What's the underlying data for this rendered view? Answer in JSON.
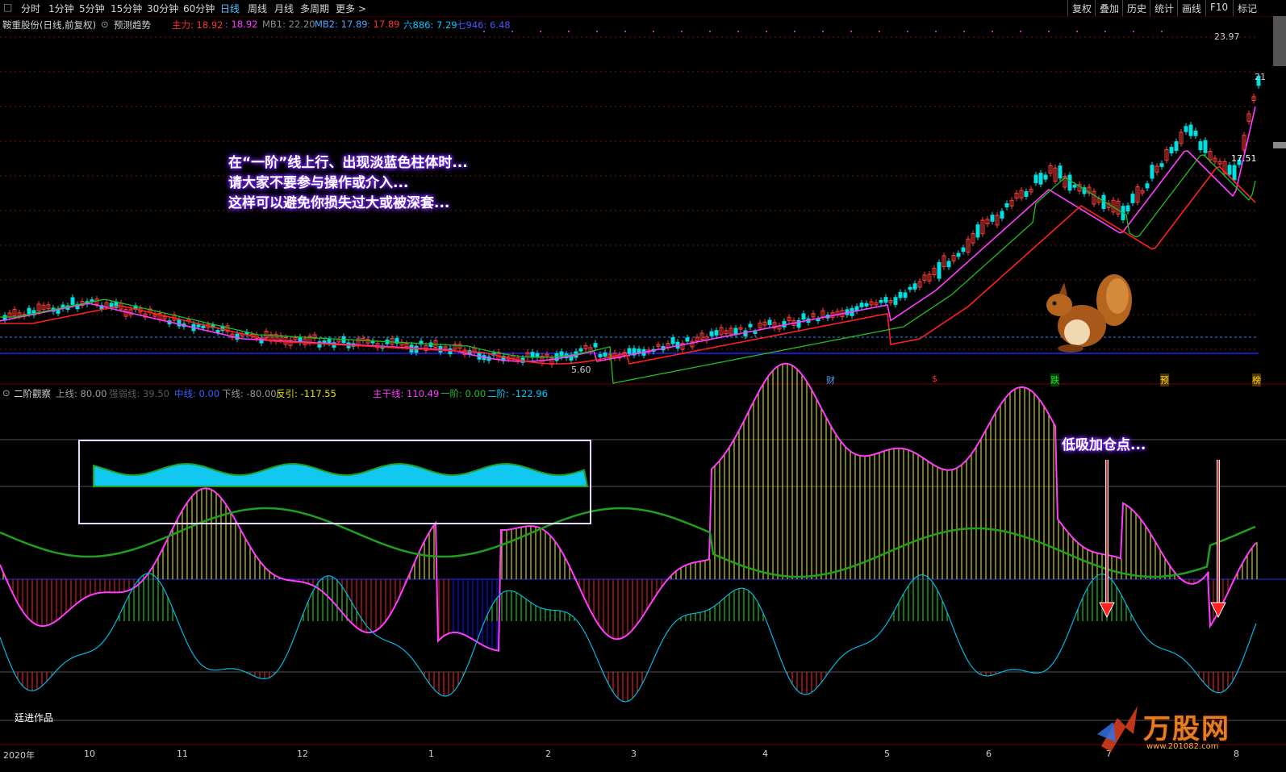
{
  "toolbar": {
    "periods": [
      "分时",
      "1分钟",
      "5分钟",
      "15分钟",
      "30分钟",
      "60分钟",
      "日线",
      "周线",
      "月线",
      "多周期",
      "更多 >"
    ],
    "active_period": "日线",
    "right_buttons": [
      "复权",
      "叠加",
      "历史",
      "统计",
      "画线",
      "F10",
      "标记"
    ]
  },
  "main_chart": {
    "title": "鞍重股份(日线,前复权)",
    "trend_toggle": "预测趋势",
    "indicators": [
      {
        "label": "主力: 18.92",
        "color": "#ff3030"
      },
      {
        "label": ": 18.92",
        "color": "#ff3cff"
      },
      {
        "label": "MB1: 22.20",
        "color": "#8a8a8a"
      },
      {
        "label": "MB2: 17.89",
        "color": "#4da3ff"
      },
      {
        "label": ": 17.89",
        "color": "#ff3030"
      },
      {
        "label": "六886: 7.29",
        "color": "#00c8ff"
      },
      {
        "label": "七946: 6.48",
        "color": "#5050ff"
      }
    ],
    "price_high": "23.97",
    "price_right_top": "21",
    "price_current": "17.51",
    "price_low": "5.60",
    "events": [
      "财",
      "$",
      "跌",
      "预",
      "榜"
    ],
    "annotation": [
      "在“一阶”线上行、出现淡蓝色柱体时...",
      "请大家不要参与操作或介入...",
      "这样可以避免你损失过大或被深套..."
    ]
  },
  "indicator_panel": {
    "name": "二阶觀察",
    "values": [
      {
        "label": "上线: 80.00",
        "color": "#9a9a9a"
      },
      {
        "label": "强弱线: 39.50",
        "color": "#5a5a5a"
      },
      {
        "label": "中线: 0.00",
        "color": "#3a5cff"
      },
      {
        "label": "下线: -80.00",
        "color": "#9a9a9a"
      },
      {
        "label": "反引: -117.55",
        "color": "#e6e600"
      },
      {
        "label": "主干线: 110.49",
        "color": "#ff3cff"
      },
      {
        "label": "一阶: 0.00",
        "color": "#20c020"
      },
      {
        "label": "二阶: -122.96",
        "color": "#00c8ff"
      }
    ],
    "annotation": "低吸加仓点...",
    "author": "廷进作品"
  },
  "date_axis": [
    "2020年",
    "10",
    "11",
    "12",
    "1",
    "2",
    "3",
    "4",
    "5",
    "6",
    "7",
    "8"
  ],
  "watermark": {
    "name": "万股网",
    "url": "www.201082.com"
  },
  "colors": {
    "up": "#ff3c3c",
    "down": "#00e0e0",
    "ma_magenta": "#ff3cff",
    "ma_red": "#ff2020",
    "ma_green": "#20c020"
  }
}
